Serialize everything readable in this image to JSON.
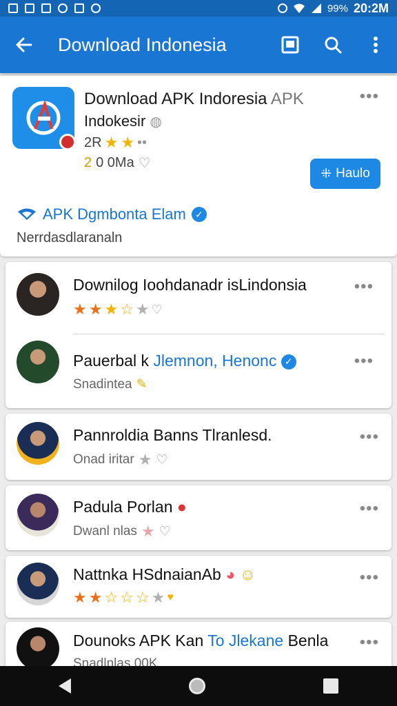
{
  "status_bar": {
    "battery_pct": "99%",
    "time": "20:2M"
  },
  "app_bar": {
    "title": "Download Indonesia"
  },
  "app_card": {
    "title_main": "Download APK Indoresia",
    "title_muted": "APK",
    "subtitle": "Indokesir",
    "rating_text": "2R",
    "size_num": "2",
    "size_text": "0 0Ma",
    "install_label": "Haulo",
    "developer": "APK Dgmbonta Elam",
    "description": "Nerrdasdlaranaln"
  },
  "items": [
    {
      "title": "Downilog Ioohdanadr isLindonsia",
      "stars": 3
    },
    {
      "title_main": "Pauerbal k",
      "title_blue": "Jlemnon, Henonc",
      "subtitle": "Snadintea"
    },
    {
      "title": "Pannroldia Banns Tlranlesd.",
      "subtitle": "Onad iritar"
    },
    {
      "title": "Padula Porlan",
      "subtitle": "Dwanl nlas"
    },
    {
      "title": "Nattnka HSdnaianAb",
      "stars": 2
    },
    {
      "title_main": "Dounoks APK Kan",
      "title_blue": "To Jlekane",
      "title_tail": "Benla",
      "subtitle": "Snadlnlas 00K"
    }
  ],
  "colors": {
    "appbar": "#1976d2",
    "accent": "#1e88e5",
    "statusbar": "#1565b5"
  }
}
